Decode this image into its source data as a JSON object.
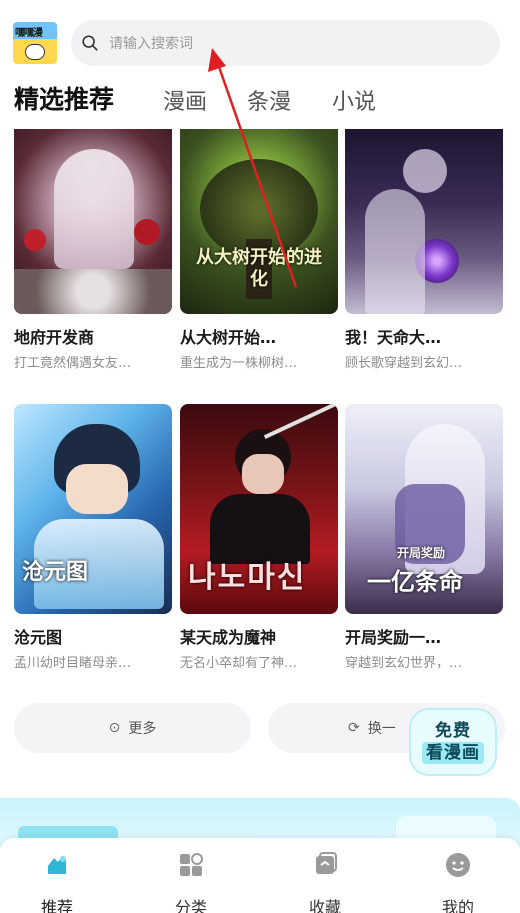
{
  "header": {
    "logo_text": "嘿嘿漫",
    "search_placeholder": "请输入搜索词"
  },
  "tabs": [
    {
      "label": "精选推荐",
      "active": true
    },
    {
      "label": "漫画",
      "active": false
    },
    {
      "label": "条漫",
      "active": false
    },
    {
      "label": "小说",
      "active": false
    }
  ],
  "cards": [
    {
      "title": "地府开发商",
      "subtitle": "打工竟然偶遇女友…"
    },
    {
      "title": "从大树开始…",
      "subtitle": "重生成为一株柳树…",
      "cover_text": "从大树开始的进化"
    },
    {
      "title": "我！天命大…",
      "subtitle": "顾长歌穿越到玄幻…"
    },
    {
      "title": "沧元图",
      "subtitle": "孟川幼时目睹母亲…",
      "cover_text": "沧元图"
    },
    {
      "title": "某天成为魔神",
      "subtitle": "无名小卒却有了神…",
      "cover_text": "나노마신"
    },
    {
      "title": "开局奖励一…",
      "subtitle": "穿越到玄幻世界，…",
      "cover_text_top": "开局奖励",
      "cover_text": "一亿条命"
    }
  ],
  "actions": {
    "more_label": "更多",
    "refresh_label": "换一"
  },
  "free_badge": {
    "line1": "免费",
    "line2": "看漫画"
  },
  "bottom_nav": [
    {
      "label": "推荐",
      "icon": "recommend-icon",
      "active": true
    },
    {
      "label": "分类",
      "icon": "category-icon",
      "active": false
    },
    {
      "label": "收藏",
      "icon": "favorites-icon",
      "active": false
    },
    {
      "label": "我的",
      "icon": "profile-icon",
      "active": false
    }
  ],
  "colors": {
    "accent": "#8ee5f2",
    "annotation_arrow": "#e02020"
  }
}
